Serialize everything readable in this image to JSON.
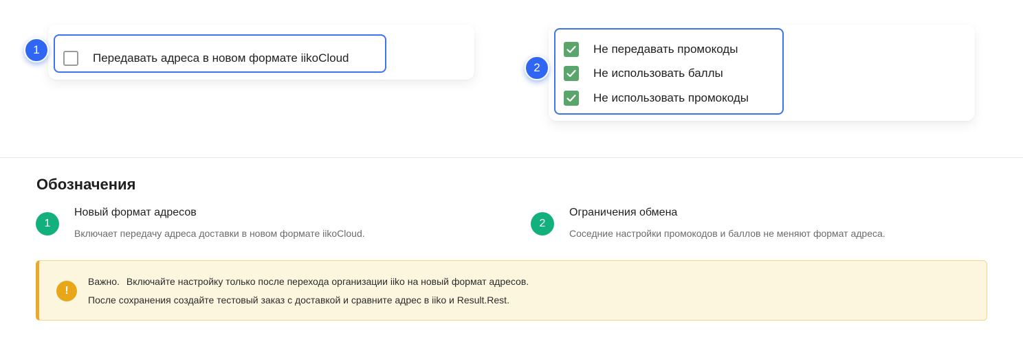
{
  "settings": {
    "card1": {
      "marker": "1",
      "checkbox": {
        "label": "Передавать адреса в новом формате iikoCloud",
        "checked": false
      }
    },
    "card2": {
      "marker": "2",
      "checkboxes": [
        {
          "label": "Не передавать промокоды",
          "checked": true
        },
        {
          "label": "Не использовать баллы",
          "checked": true
        },
        {
          "label": "Не использовать промокоды",
          "checked": true
        }
      ]
    }
  },
  "legend": {
    "title": "Обозначения",
    "items": [
      {
        "num": "1",
        "title": "Новый формат адресов",
        "desc": "Включает передачу адреса доставки в новом формате iikoCloud."
      },
      {
        "num": "2",
        "title": "Ограничения обмена",
        "desc": "Соседние настройки промокодов и баллов не меняют формат адреса."
      }
    ]
  },
  "warning": {
    "icon": "!",
    "label": "Важно.",
    "line1": "Включайте настройку только после перехода организации iiko на новый формат адресов.",
    "line2": "После сохранения создайте тестовый заказ с доставкой и сравните адрес в iiko и Result.Rest."
  },
  "colors": {
    "highlight": "#3d73ee",
    "marker": "#2f66f3",
    "checked": "#5aa56c",
    "legend_num": "#12b07c",
    "warning_accent": "#e9a92a"
  }
}
